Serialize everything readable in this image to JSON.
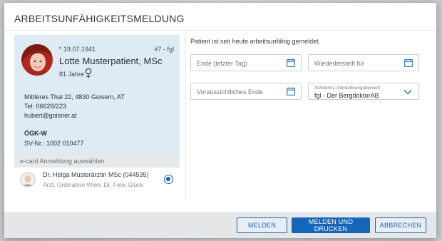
{
  "dialog": {
    "title": "ARBEITSUNFÄHIGKEITSMELDUNG"
  },
  "patient": {
    "dob": "* 19.07.1941",
    "ref": "#7 - fgl",
    "name": "Lotte Musterpatient, MSc",
    "age": "81 Jahre",
    "gender_icon": "female-symbol-icon",
    "address": "Mittleres Thal 22, 4830 Goisern, AT",
    "phone": "Tel: 06628/223",
    "email": "hubert@goisner.at",
    "insurance": "ÖGK-W",
    "svnr": "SV-Nr.: 1002 010477"
  },
  "ecard": {
    "header": "e-card Anmeldung auswählen",
    "doctor_name": "Dr. Helga Musterärztin MSc (044535)",
    "doctor_sub": "Arzt, Ordination Wien, Dr. Felix Glück",
    "selected": true
  },
  "form": {
    "status_text": "Patient ist seit heute arbeitsunfähig gemeldet.",
    "end_placeholder": "Ende (letzter Tag)",
    "reorder_placeholder": "Wiederbestellt für",
    "expected_end_placeholder": "Voraussichtliches Ende",
    "billing_label": "Arztkennz./Abrechnungsbereich",
    "billing_value": "fgl - Der BergdoktorAB"
  },
  "footer": {
    "report_label": "MELDEN",
    "report_print_label": "MELDEN UND DRUCKEN",
    "cancel_label": "ABBRECHEN"
  },
  "colors": {
    "accent": "#1565b8",
    "card_bg": "#deeaf4",
    "footer_bg": "#e4e6e8"
  }
}
